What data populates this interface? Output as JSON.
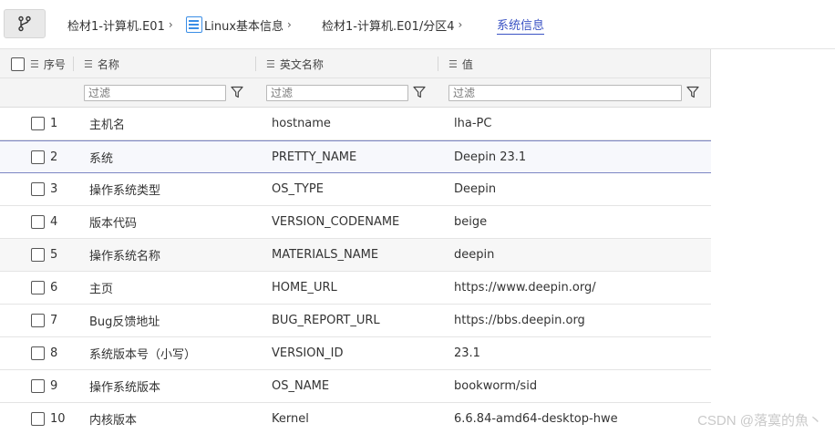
{
  "breadcrumb": {
    "items": [
      {
        "label": "检材1-计算机.E01"
      },
      {
        "label": "Linux基本信息"
      },
      {
        "label": "检材1-计算机.E01/分区4"
      },
      {
        "label": "系统信息"
      }
    ]
  },
  "table": {
    "columns": [
      {
        "label": "序号"
      },
      {
        "label": "名称"
      },
      {
        "label": "英文名称"
      },
      {
        "label": "值"
      }
    ],
    "filter_placeholder": "过滤",
    "rows": [
      {
        "index": "1",
        "name": "主机名",
        "en_name": "hostname",
        "value": "lha-PC"
      },
      {
        "index": "2",
        "name": "系统",
        "en_name": "PRETTY_NAME",
        "value": "Deepin 23.1"
      },
      {
        "index": "3",
        "name": "操作系统类型",
        "en_name": "OS_TYPE",
        "value": "Deepin"
      },
      {
        "index": "4",
        "name": "版本代码",
        "en_name": "VERSION_CODENAME",
        "value": "beige"
      },
      {
        "index": "5",
        "name": "操作系统名称",
        "en_name": "MATERIALS_NAME",
        "value": "deepin"
      },
      {
        "index": "6",
        "name": "主页",
        "en_name": "HOME_URL",
        "value": "https://www.deepin.org/"
      },
      {
        "index": "7",
        "name": "Bug反馈地址",
        "en_name": "BUG_REPORT_URL",
        "value": "https://bbs.deepin.org"
      },
      {
        "index": "8",
        "name": "系统版本号（小写）",
        "en_name": "VERSION_ID",
        "value": "23.1"
      },
      {
        "index": "9",
        "name": "操作系统版本",
        "en_name": "OS_NAME",
        "value": "bookworm/sid"
      },
      {
        "index": "10",
        "name": "内核版本",
        "en_name": "Kernel",
        "value": "6.6.84-amd64-desktop-hwe"
      }
    ]
  },
  "watermark": "CSDN @落寞的魚丶",
  "icons": {
    "branch": "git-branch-icon",
    "list": "list-icon",
    "menu": "column-menu-icon",
    "filter": "funnel-icon"
  },
  "colors": {
    "accent": "#3b53c4",
    "list_icon": "#3a8ee6",
    "selected_border": "#7d86c4"
  }
}
